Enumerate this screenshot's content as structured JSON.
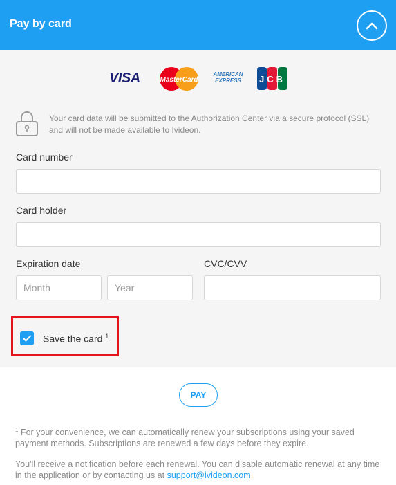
{
  "header": {
    "title": "Pay by card",
    "collapse_icon": "chevron-up-icon",
    "color": "#1e9ff2"
  },
  "card_logos": {
    "visa": "VISA",
    "mastercard": "MasterCard",
    "amex_line1": "AMERICAN",
    "amex_line2": "EXPRESS",
    "jcb": "JCB"
  },
  "security": {
    "icon": "lock-icon",
    "text": "Your card data will be submitted to the Authorization Center via a secure protocol (SSL) and will not be made available to Ivideon."
  },
  "form": {
    "card_number_label": "Card number",
    "card_number_value": "",
    "card_holder_label": "Card holder",
    "card_holder_value": "",
    "expiration_label": "Expiration date",
    "month_placeholder": "Month",
    "year_placeholder": "Year",
    "cvc_label": "CVC/CVV",
    "cvc_value": "",
    "save_card_label": "Save the card",
    "save_card_footnote_ref": "1",
    "save_card_checked": true
  },
  "pay_button": "PAY",
  "footnotes": {
    "marker": "1",
    "note1": "For your convenience, we can automatically renew your subscriptions using your saved payment methods. Subscriptions are renewed a few days before they expire.",
    "note2_prefix": "You'll receive a notification before each renewal. You can disable automatic renewal at any time in the application or by contacting us at",
    "support_email": "support@ivideon.com",
    "note2_suffix": "."
  },
  "colors": {
    "accent": "#1e9ff2",
    "highlight": "#e3141b",
    "panel": "#f5f5f5"
  }
}
